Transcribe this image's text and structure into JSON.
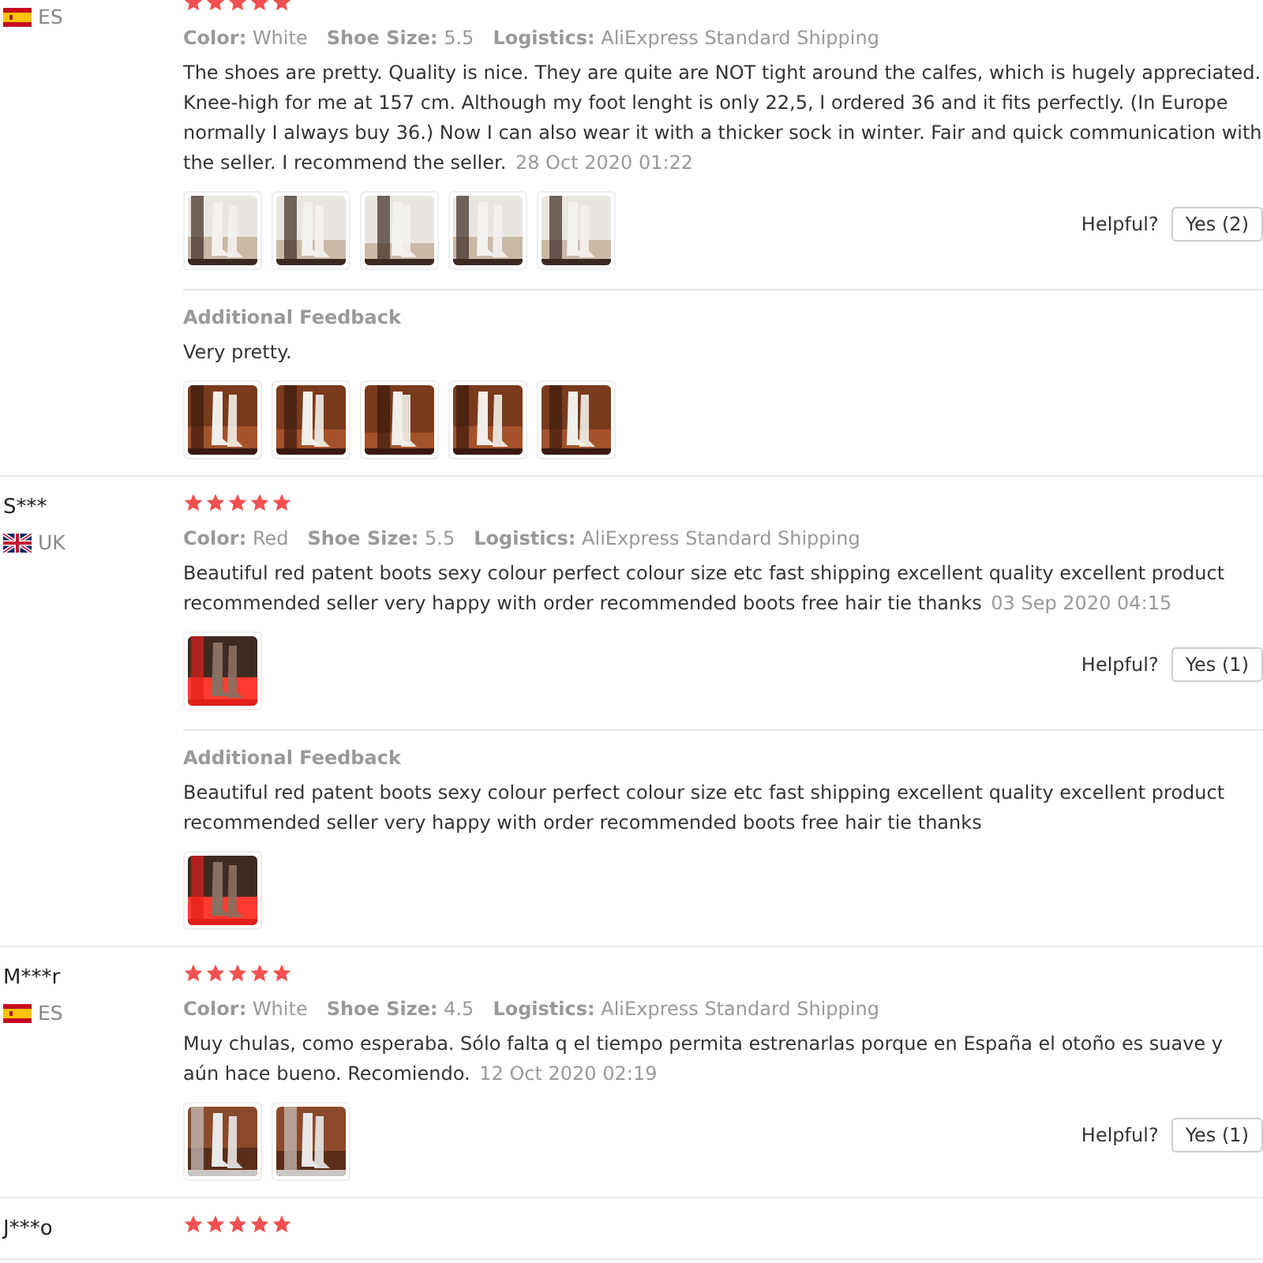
{
  "reviews": [
    {
      "flag": {
        "kind": "spain"
      },
      "country": "ES",
      "stars": 5,
      "meta": [
        {
          "label": "Color:",
          "value": "White"
        },
        {
          "label": "Shoe Size:",
          "value": "5.5"
        },
        {
          "label": "Logistics:",
          "value": "AliExpress Standard Shipping"
        }
      ],
      "text": "The shoes are pretty. Quality is nice. They are quite are NOT tight around the calfes, which is hugely appreciated. Knee-high for me at 157 cm. Although my foot lenght is only 22,5, I ordered 36 and it fits perfectly. (In Europe normally I always buy 36.) Now I can also wear it with a thicker sock in winter. Fair and quick communication with the seller. I recommend the seller.",
      "date": "28 Oct 2020 01:22",
      "photos": [
        {
          "kind": "picture"
        },
        {
          "kind": "picture"
        },
        {
          "kind": "picture"
        },
        {
          "kind": "picture"
        },
        {
          "kind": "picture"
        }
      ],
      "helpful_label": "Helpful?",
      "helpful_button": "Yes (2)",
      "additional": {
        "title": "Additional Feedback",
        "text": "Very pretty.",
        "photos": [
          {
            "kind": "picture"
          },
          {
            "kind": "picture"
          },
          {
            "kind": "picture"
          },
          {
            "kind": "picture"
          },
          {
            "kind": "picture"
          }
        ]
      }
    },
    {
      "name": "S***",
      "flag": {
        "kind": "uk"
      },
      "country": "UK",
      "stars": 5,
      "meta": [
        {
          "label": "Color:",
          "value": "Red"
        },
        {
          "label": "Shoe Size:",
          "value": "5.5"
        },
        {
          "label": "Logistics:",
          "value": "AliExpress Standard Shipping"
        }
      ],
      "text": "Beautiful red patent boots sexy colour perfect colour size etc fast shipping excellent quality excellent product recommended seller very happy with order recommended boots free hair tie thanks",
      "date": "03 Sep 2020 04:15",
      "photos": [
        {
          "kind": "picture"
        }
      ],
      "helpful_label": "Helpful?",
      "helpful_button": "Yes (1)",
      "additional": {
        "title": "Additional Feedback",
        "text": "Beautiful red patent boots sexy colour perfect colour size etc fast shipping excellent quality excellent product recommended seller very happy with order recommended boots free hair tie thanks",
        "photos": [
          {
            "kind": "picture"
          }
        ]
      }
    },
    {
      "name": "M***r",
      "flag": {
        "kind": "spain"
      },
      "country": "ES",
      "stars": 5,
      "meta": [
        {
          "label": "Color:",
          "value": "White"
        },
        {
          "label": "Shoe Size:",
          "value": "4.5"
        },
        {
          "label": "Logistics:",
          "value": "AliExpress Standard Shipping"
        }
      ],
      "text": "Muy chulas, como esperaba. Sólo falta q el tiempo permita estrenarlas porque en España el otoño es suave y aún hace bueno. Recomiendo.",
      "date": "12 Oct 2020 02:19",
      "photos": [
        {
          "kind": "picture"
        },
        {
          "kind": "picture"
        }
      ],
      "helpful_label": "Helpful?",
      "helpful_button": "Yes (1)"
    },
    {
      "name": "J***o",
      "stars": 5
    }
  ]
}
